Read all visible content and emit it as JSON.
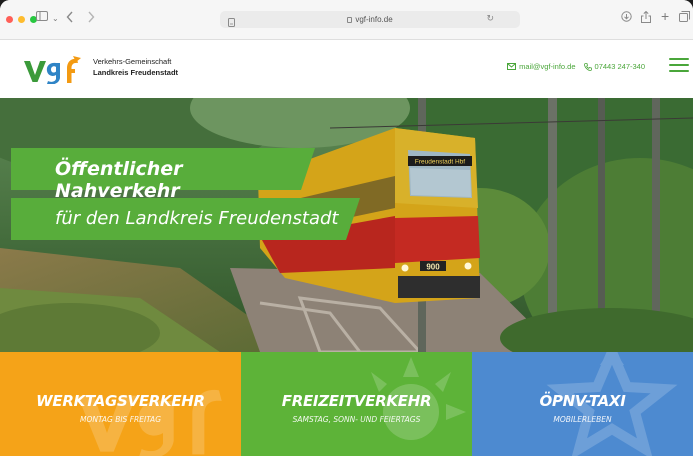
{
  "browser": {
    "url": "vgf-info.de"
  },
  "header": {
    "org_line1": "Verkehrs-Gemeinschaft",
    "org_line2": "Landkreis Freudenstadt",
    "email": "mail@vgf-info.de",
    "phone": "07443 247-340"
  },
  "hero": {
    "headline": "Öffentlicher Nahverkehr",
    "subline": "für den Landkreis Freudenstadt",
    "train_destination": "Freudenstadt Hbf",
    "train_number": "900"
  },
  "tiles": [
    {
      "title": "WERKTAGSVERKEHR",
      "subtitle": "MONTAG BIS FREITAG"
    },
    {
      "title": "FREIZEITVERKEHR",
      "subtitle": "SAMSTAG, SONN- UND FEIERTAGS"
    },
    {
      "title": "ÖPNV-TAXI",
      "subtitle": "MOBILERLEBEN"
    }
  ],
  "colors": {
    "brand_green": "#58ad3b",
    "tile_orange": "#f5a318",
    "tile_green": "#5db338",
    "tile_blue": "#4d8ad0"
  }
}
